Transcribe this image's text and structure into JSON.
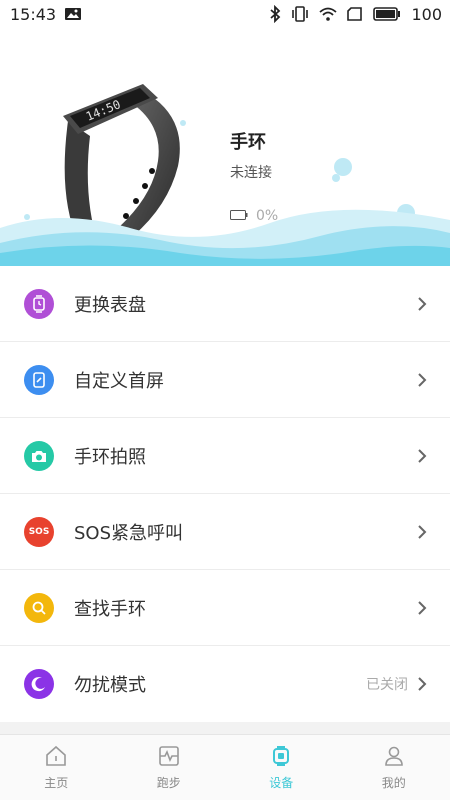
{
  "status_bar": {
    "time": "15:43",
    "battery_level": "100",
    "icons": [
      "image-icon",
      "bluetooth-icon",
      "vibrate-icon",
      "wifi-icon",
      "sim-icon",
      "battery-icon"
    ]
  },
  "device": {
    "name": "手环",
    "connection_status": "未连接",
    "battery": "0%",
    "image": "fitness-band-image"
  },
  "menu": {
    "items": [
      {
        "label": "更换表盘",
        "icon": "watch-face-icon",
        "color": "#b04fd6",
        "value": ""
      },
      {
        "label": "自定义首屏",
        "icon": "custom-screen-icon",
        "color": "#3d8ef0",
        "value": ""
      },
      {
        "label": "手环拍照",
        "icon": "camera-icon",
        "color": "#25c9a6",
        "value": ""
      },
      {
        "label": "SOS紧急呼叫",
        "icon": "sos-icon",
        "color": "#e8422e",
        "value": "",
        "icon_text": "SOS"
      },
      {
        "label": "查找手环",
        "icon": "search-icon",
        "color": "#f3b70c",
        "value": ""
      },
      {
        "label": "勿扰模式",
        "icon": "moon-icon",
        "color": "#8b33e6",
        "value": "已关闭"
      }
    ]
  },
  "tabbar": {
    "tabs": [
      {
        "label": "主页",
        "icon": "home-icon",
        "active": false
      },
      {
        "label": "跑步",
        "icon": "running-icon",
        "active": false
      },
      {
        "label": "设备",
        "icon": "device-icon",
        "active": true
      },
      {
        "label": "我的",
        "icon": "profile-icon",
        "active": false
      }
    ]
  },
  "colors": {
    "accent": "#3ec8d6",
    "wave": "#7fd8ef"
  }
}
